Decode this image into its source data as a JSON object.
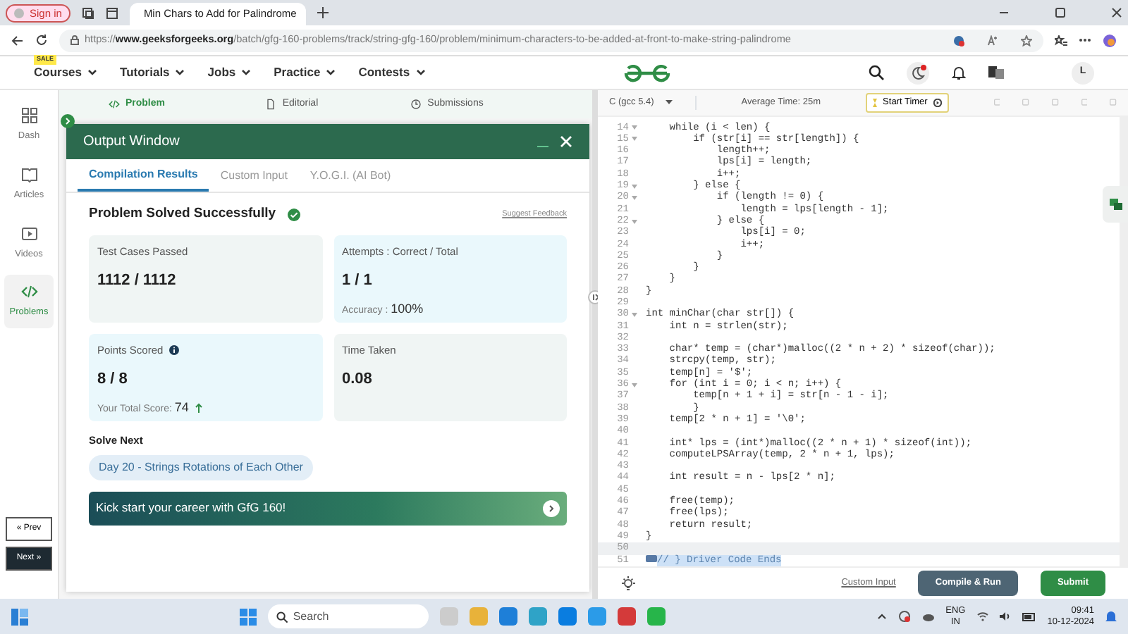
{
  "browser": {
    "sign_in": "Sign in",
    "tab_title": "Min Chars to Add for Palindrome",
    "url": "https://**www.geeksforgeeks.org**/batch/gfg-160-problems/track/string-gfg-160/problem/minimum-characters-to-be-added-at-front-to-make-string-palindrome"
  },
  "site_nav": {
    "sale_badge": "SALE",
    "items": [
      "Courses",
      "Tutorials",
      "Jobs",
      "Practice",
      "Contests"
    ],
    "avatar": "L"
  },
  "sidebar": {
    "items": [
      {
        "label": "Dash",
        "selected": false
      },
      {
        "label": "Articles",
        "selected": false
      },
      {
        "label": "Videos",
        "selected": false
      },
      {
        "label": "Problems",
        "selected": true
      }
    ],
    "prev": "« Prev",
    "next": "Next »"
  },
  "problem_tabs": [
    {
      "label": "Problem",
      "selected": true
    },
    {
      "label": "Editorial",
      "selected": false
    },
    {
      "label": "Submissions",
      "selected": false
    }
  ],
  "output_window": {
    "title": "Output Window",
    "tabs": [
      {
        "label": "Compilation Results",
        "selected": true
      },
      {
        "label": "Custom Input",
        "selected": false
      },
      {
        "label": "Y.O.G.I. (AI Bot)",
        "selected": false
      }
    ],
    "status": "Problem Solved Successfully",
    "feedback_link": "Suggest Feedback",
    "cards": [
      {
        "label": "Test Cases Passed",
        "value": "1112 / 1112",
        "color": "#f0f5f4"
      },
      {
        "label": "Attempts : Correct / Total",
        "value": "1 / 1",
        "note": "Accuracy : ",
        "note_value": "100%",
        "color": "#eaf8fc"
      },
      {
        "label": "Points Scored",
        "info": true,
        "value": "8 / 8",
        "note": "Your Total Score: ",
        "note_value": "74",
        "trend_up": true,
        "color": "#eaf8fc"
      },
      {
        "label": "Time Taken",
        "value": "0.08",
        "color": "#f0f5f4"
      }
    ],
    "solve_next_heading": "Solve Next",
    "solve_next_chip": "Day 20 - Strings Rotations of Each Other",
    "banner": "Kick start your career with GfG 160!"
  },
  "editor": {
    "language": "C (gcc 5.4)",
    "average_time": "Average Time: 25m",
    "start_timer": "Start Timer",
    "lines": [
      {
        "n": "14",
        "text": "    while (i < len) {",
        "fold": true
      },
      {
        "n": "15",
        "text": "        if (str[i] == str[length]) {",
        "fold": true
      },
      {
        "n": "16",
        "text": "            length++;"
      },
      {
        "n": "17",
        "text": "            lps[i] = length;"
      },
      {
        "n": "18",
        "text": "            i++;"
      },
      {
        "n": "19",
        "text": "        } else {",
        "fold": true
      },
      {
        "n": "20",
        "text": "            if (length != 0) {",
        "fold": true
      },
      {
        "n": "21",
        "text": "                length = lps[length - 1];"
      },
      {
        "n": "22",
        "text": "            } else {",
        "fold": true
      },
      {
        "n": "23",
        "text": "                lps[i] = 0;"
      },
      {
        "n": "24",
        "text": "                i++;"
      },
      {
        "n": "25",
        "text": "            }"
      },
      {
        "n": "26",
        "text": "        }"
      },
      {
        "n": "27",
        "text": "    }"
      },
      {
        "n": "28",
        "text": "}"
      },
      {
        "n": "29"
      },
      {
        "n": "30",
        "text": "int minChar(char str[]) {",
        "fold": true
      },
      {
        "n": "31",
        "text": "    int n = strlen(str);"
      },
      {
        "n": "32"
      },
      {
        "n": "33",
        "text": "    char* temp = (char*)malloc((2 * n + 2) * sizeof(char));"
      },
      {
        "n": "34",
        "text": "    strcpy(temp, str);"
      },
      {
        "n": "35",
        "text": "    temp[n] = '$';"
      },
      {
        "n": "36",
        "text": "    for (int i = 0; i < n; i++) {",
        "fold": true
      },
      {
        "n": "37",
        "text": "        temp[n + 1 + i] = str[n - 1 - i];"
      },
      {
        "n": "38",
        "text": "        }"
      },
      {
        "n": "39",
        "text": "    temp[2 * n + 1] = '\\0';"
      },
      {
        "n": "40"
      },
      {
        "n": "41",
        "text": "    int* lps = (int*)malloc((2 * n + 1) * sizeof(int));"
      },
      {
        "n": "42",
        "text": "    computeLPSArray(temp, 2 * n + 1, lps);"
      },
      {
        "n": "43"
      },
      {
        "n": "44",
        "text": "    int result = n - lps[2 * n];"
      },
      {
        "n": "45"
      },
      {
        "n": "46",
        "text": "    free(temp);"
      },
      {
        "n": "47",
        "text": "    free(lps);"
      },
      {
        "n": "48",
        "text": "    return result;"
      },
      {
        "n": "49",
        "text": "}"
      },
      {
        "n": "50",
        "active": true
      },
      {
        "n": "51",
        "text": "// } Driver Code Ends",
        "folded": true,
        "selected": true
      }
    ],
    "custom_input": "Custom Input",
    "compile": "Compile & Run",
    "submit": "Submit"
  },
  "taskbar": {
    "search": "Search",
    "lang": "ENG",
    "region": "IN",
    "time": "09:41",
    "date": "10-12-2024"
  }
}
